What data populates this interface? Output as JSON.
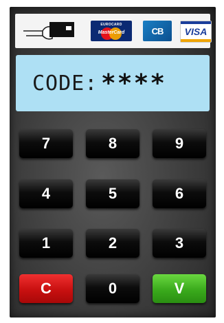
{
  "card_logos": {
    "mastercard": {
      "top_text": "EUROCARD",
      "brand_text": "MasterCard"
    },
    "cb": {
      "text": "CB"
    },
    "visa": {
      "text": "VISA"
    }
  },
  "display": {
    "label": "CODE:",
    "masked_pin": "****"
  },
  "keypad": {
    "k7": "7",
    "k8": "8",
    "k9": "9",
    "k4": "4",
    "k5": "5",
    "k6": "6",
    "k1": "1",
    "k2": "2",
    "k3": "3",
    "clear": "C",
    "k0": "0",
    "validate": "V"
  },
  "colors": {
    "display_bg": "#aee0f4",
    "clear_key": "#d81818",
    "validate_key": "#3aaa1c",
    "digit_key": "#0c0c0c"
  }
}
